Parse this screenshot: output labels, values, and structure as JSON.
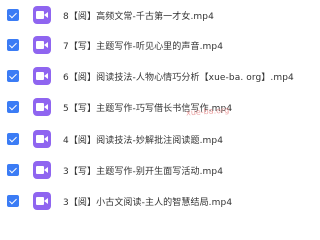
{
  "files": [
    {
      "name": "8【阅】高频文常-千古第一才女.mp4"
    },
    {
      "name": "7【写】主题写作-听见心里的声音.mp4"
    },
    {
      "name": "6【阅】阅读技法-人物心情巧分析【xue-ba. org】.mp4"
    },
    {
      "name": "5【写】主题写作-巧写借长书信写作.mp4"
    },
    {
      "name": "4【阅】阅读技法-妙解批注阅读题.mp4"
    },
    {
      "name": "3【写】主题写作-别开生面写活动.mp4"
    },
    {
      "name": "3【阅】小古文阅读-主人的智慧结局.mp4"
    }
  ],
  "watermark": "xue-ba.org",
  "colors": {
    "checkbox": "#3b7cf5",
    "video_icon": "#8f65f0"
  }
}
